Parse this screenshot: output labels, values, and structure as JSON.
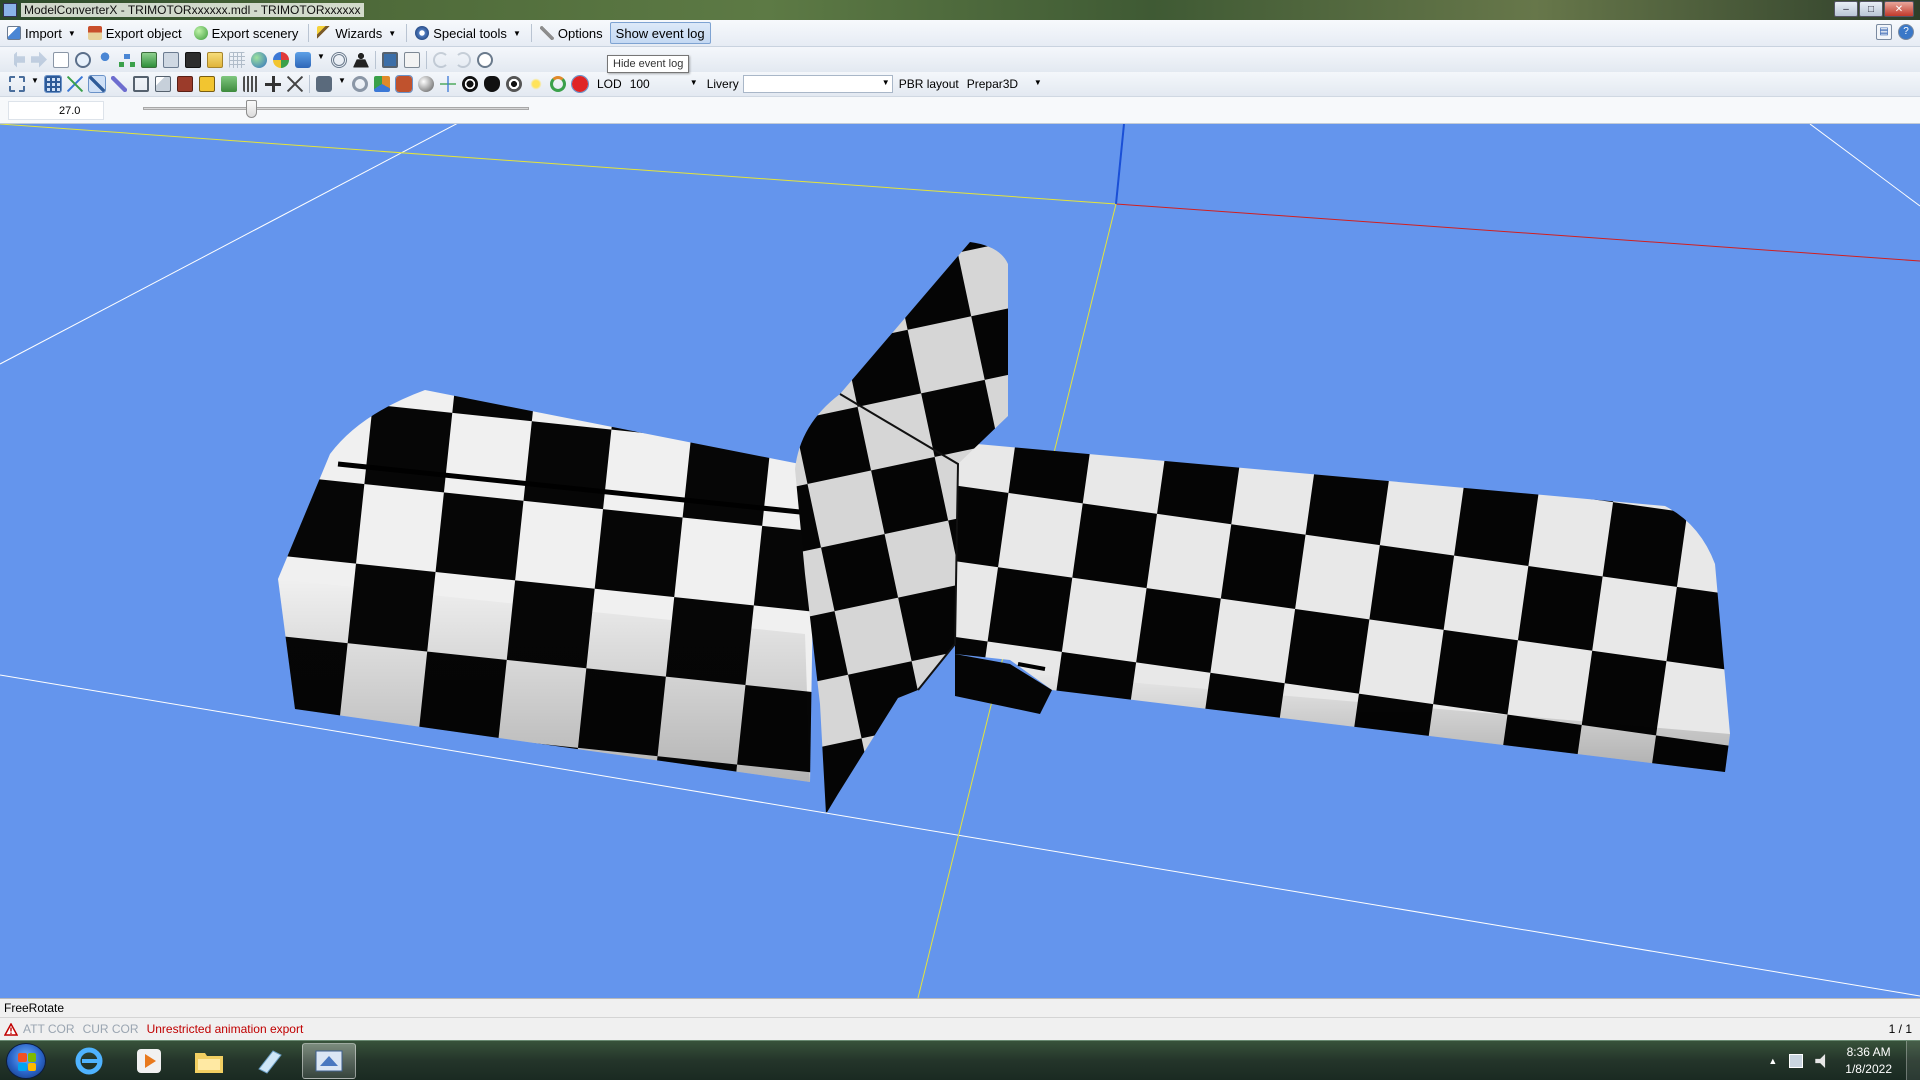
{
  "window": {
    "title": "ModelConverterX - TRIMOTORxxxxxx.mdl - TRIMOTORxxxxxx",
    "minimize_icon": "minimize-icon",
    "maximize_icon": "maximize-icon",
    "close_icon": "close-icon"
  },
  "menu": {
    "import": "Import",
    "export_object": "Export object",
    "export_scenery": "Export scenery",
    "wizards": "Wizards",
    "special_tools": "Special tools",
    "options": "Options",
    "show_event_log": "Show event log"
  },
  "tooltip": "Hide event log",
  "toolbar": {
    "lod_label": "LOD",
    "lod_value": "100",
    "livery_label": "Livery",
    "livery_value": "",
    "pbr_label": "PBR layout",
    "pbr_value": "Prepar3D"
  },
  "slider": {
    "value_text": "27.0",
    "position": 0.28
  },
  "viewport": {
    "background": "#6495ed",
    "axis_colors": {
      "x": "#d21f1f",
      "y": "#1a4fd6",
      "z": "#e4e43a",
      "grid": "#ffffff"
    }
  },
  "status": {
    "mode": "FreeRotate",
    "att_cor": "ATT COR",
    "cur_cor": "CUR COR",
    "warning": "Unrestricted animation export",
    "page": "1 / 1"
  },
  "taskbar": {
    "time": "8:36 AM",
    "date": "1/8/2022",
    "apps": [
      "internet-explorer-icon",
      "media-player-icon",
      "file-explorer-icon",
      "notepad-icon",
      "modelconverterx-icon"
    ]
  }
}
